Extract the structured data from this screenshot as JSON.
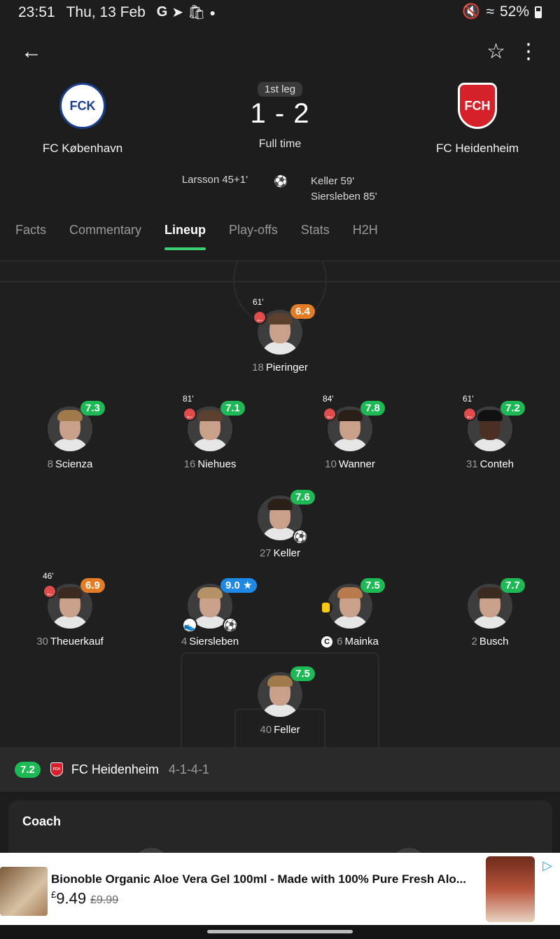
{
  "statusbar": {
    "time": "23:51",
    "date": "Thu, 13 Feb",
    "icons": [
      "google-icon",
      "telegram-icon",
      "shopping-bag-icon",
      "dot-icon"
    ],
    "battery": "52%"
  },
  "match": {
    "leg": "1st leg",
    "score": "1 - 2",
    "status": "Full time",
    "home": {
      "name": "FC København",
      "crest": "FCK",
      "crest_color": "#1b3f8f"
    },
    "away": {
      "name": "FC Heidenheim",
      "crest": "FCH",
      "crest_color": "#d6202a"
    },
    "home_scorers": [
      "Larsson 45+1'"
    ],
    "away_scorers": [
      "Keller 59'",
      "Siersleben 85'"
    ]
  },
  "tabs": [
    {
      "label": "Facts"
    },
    {
      "label": "Commentary"
    },
    {
      "label": "Lineup"
    },
    {
      "label": "Play-offs"
    },
    {
      "label": "Stats"
    },
    {
      "label": "H2H"
    }
  ],
  "active_tab": "Lineup",
  "lineup": {
    "players": [
      {
        "num": "18",
        "name": "Pieringer",
        "rating": "6.4",
        "rating_color": "orange",
        "sub_min": "61'"
      },
      {
        "num": "8",
        "name": "Scienza",
        "rating": "7.3",
        "rating_color": "green"
      },
      {
        "num": "16",
        "name": "Niehues",
        "rating": "7.1",
        "rating_color": "green",
        "sub_min": "81'"
      },
      {
        "num": "10",
        "name": "Wanner",
        "rating": "7.8",
        "rating_color": "green",
        "sub_min": "84'"
      },
      {
        "num": "31",
        "name": "Conteh",
        "rating": "7.2",
        "rating_color": "green",
        "sub_min": "61'"
      },
      {
        "num": "27",
        "name": "Keller",
        "rating": "7.6",
        "rating_color": "green"
      },
      {
        "num": "30",
        "name": "Theuerkauf",
        "rating": "6.9",
        "rating_color": "orange",
        "sub_min": "46'"
      },
      {
        "num": "4",
        "name": "Siersleben",
        "rating": "9.0",
        "rating_color": "blue"
      },
      {
        "num": "6",
        "name": "Mainka",
        "rating": "7.5",
        "rating_color": "green",
        "captain": "C"
      },
      {
        "num": "2",
        "name": "Busch",
        "rating": "7.7",
        "rating_color": "green"
      },
      {
        "num": "40",
        "name": "Feller",
        "rating": "7.5",
        "rating_color": "green"
      }
    ]
  },
  "teambar": {
    "rating": "7.2",
    "crest": "FCH",
    "name": "FC Heidenheim",
    "formation": "4-1-4-1"
  },
  "coach": {
    "title": "Coach"
  },
  "ad": {
    "title": "Bionoble Organic Aloe Vera Gel 100ml - Made with 100% Pure Fresh Alo...",
    "currency": "£",
    "price": "9.49",
    "old_price": "£9.99"
  },
  "colors": {
    "rating_green": "#1db954",
    "rating_orange": "#e47c26",
    "rating_blue": "#1e88e5",
    "tab_indicator": "#3ccf72"
  }
}
